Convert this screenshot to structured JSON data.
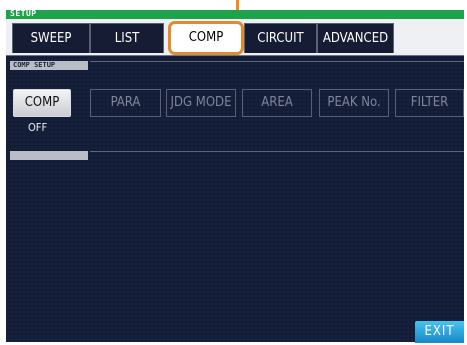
{
  "header": {
    "title": "SETUP"
  },
  "tabs": [
    {
      "label": "SWEEP",
      "active": false
    },
    {
      "label": "LIST",
      "active": false
    },
    {
      "label": "COMP",
      "active": true
    },
    {
      "label": "CIRCUIT",
      "active": false
    },
    {
      "label": "ADVANCED",
      "active": false
    }
  ],
  "section": {
    "label": "COMP SETUP"
  },
  "buttons": [
    {
      "label": "COMP",
      "enabled": true
    },
    {
      "label": "PARA",
      "enabled": false
    },
    {
      "label": "JDG MODE",
      "enabled": false
    },
    {
      "label": "AREA",
      "enabled": false
    },
    {
      "label": "PEAK No.",
      "enabled": false
    },
    {
      "label": "FILTER",
      "enabled": false
    }
  ],
  "comp_status": "OFF",
  "exit_label": "EXIT",
  "colors": {
    "accent": "#e4892e",
    "title_bar": "#1ea24a",
    "screen_bg": "#141d38",
    "exit": "#2aa3dd"
  }
}
